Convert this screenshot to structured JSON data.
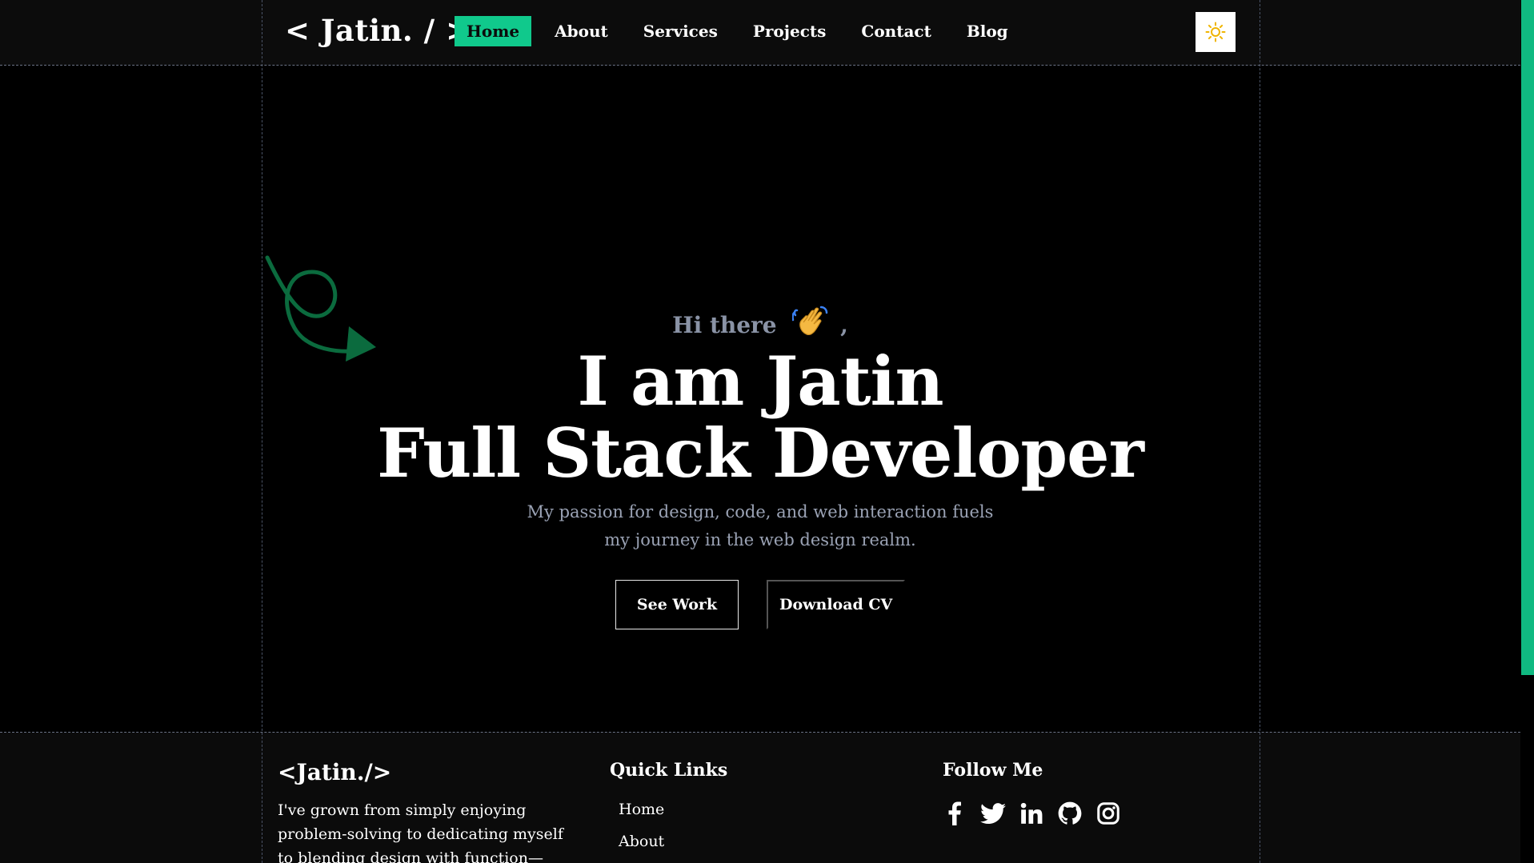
{
  "header": {
    "logo": "< Jatin. / >",
    "nav": [
      {
        "label": "Home",
        "active": true
      },
      {
        "label": "About",
        "active": false
      },
      {
        "label": "Services",
        "active": false
      },
      {
        "label": "Projects",
        "active": false
      },
      {
        "label": "Contact",
        "active": false
      },
      {
        "label": "Blog",
        "active": false
      }
    ],
    "theme_toggle_icon": "sun-icon"
  },
  "hero": {
    "greeting": "Hi there",
    "greeting_suffix": ",",
    "greeting_icon": "waving-hand-icon",
    "headline_line1": "I am Jatin",
    "headline_line2": "Full Stack Developer",
    "subtext_line1": "My passion for design, code, and web interaction fuels",
    "subtext_line2": "my journey in the web design realm.",
    "primary_button": "See Work",
    "secondary_button": "Download CV",
    "decoration_icon": "curly-arrow-icon"
  },
  "footer": {
    "brand": "<Jatin./>",
    "description": "I've grown from simply enjoying problem-solving to dedicating myself to blending design with function—",
    "quick_links_title": "Quick Links",
    "quick_links": [
      "Home",
      "About"
    ],
    "follow_title": "Follow Me",
    "socials": [
      "facebook-icon",
      "twitter-icon",
      "linkedin-icon",
      "github-icon",
      "instagram-icon"
    ]
  },
  "colors": {
    "accent": "#10c98c",
    "background": "#000000",
    "muted_text": "#9aa2b4",
    "scrollbar": "#10b981"
  }
}
